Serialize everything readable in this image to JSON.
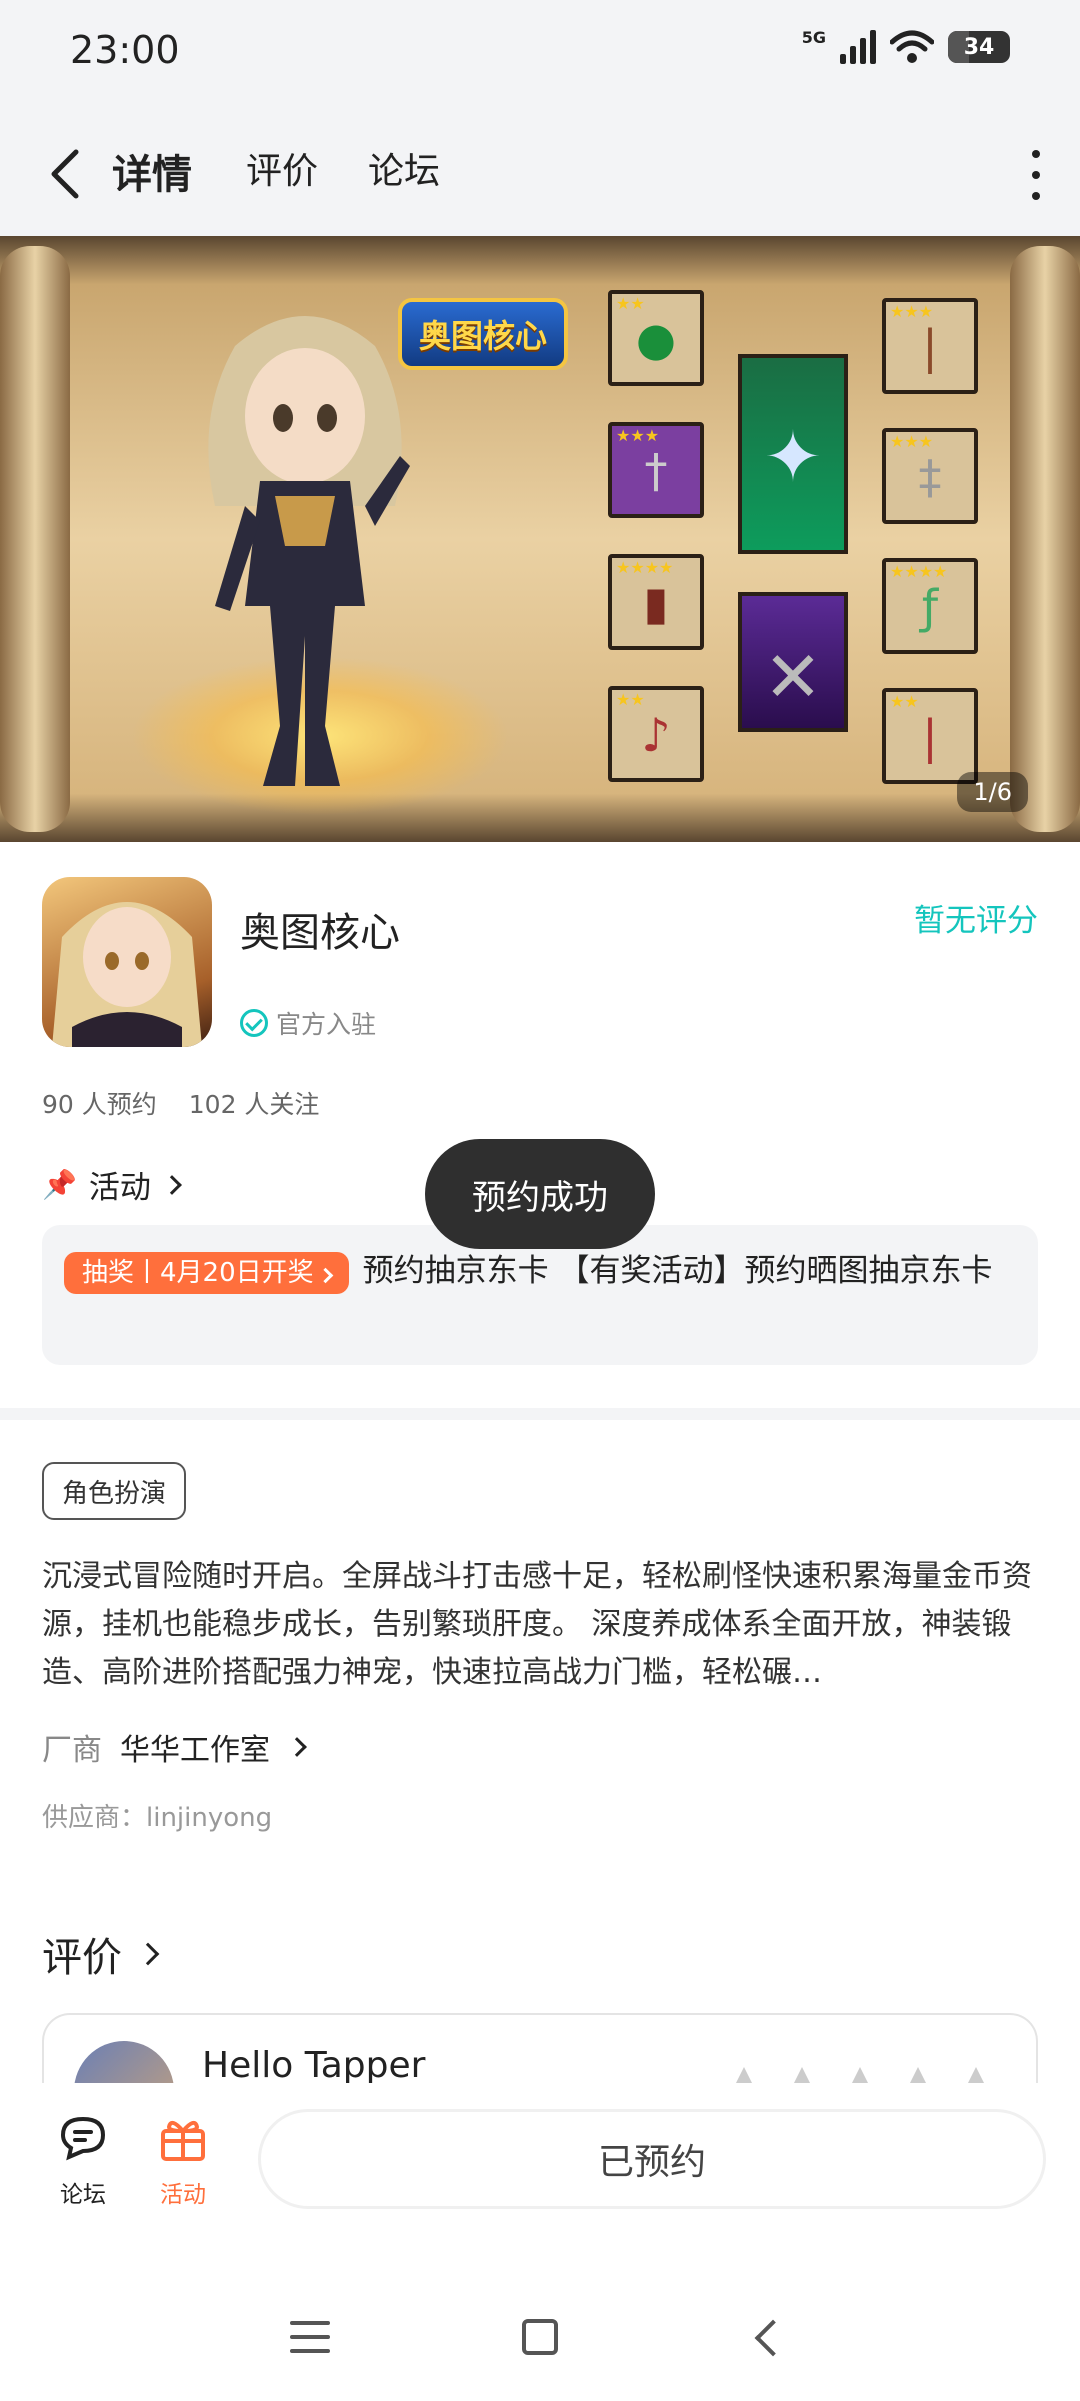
{
  "status_bar": {
    "time": "23:00",
    "network": "5G",
    "battery": "34"
  },
  "nav": {
    "tabs": [
      {
        "label": "详情",
        "active": true
      },
      {
        "label": "评价"
      },
      {
        "label": "论坛"
      }
    ]
  },
  "banner": {
    "logo_text": "奥图核心",
    "counter": "1/6"
  },
  "app": {
    "name": "奥图核心",
    "verified_label": "官方入驻",
    "rating_text": "暂无评分",
    "reservations": "90 人预约",
    "followers": "102 人关注"
  },
  "activity": {
    "title": "活动",
    "badge": "抽奖丨4月20日开奖",
    "text": "预约抽京东卡 【有奖活动】预约晒图抽京东卡"
  },
  "toast": "预约成功",
  "details": {
    "genre_tag": "角色扮演",
    "description": "沉浸式冒险随时开启。全屏战斗打击感十足，轻松刷怪快速积累海量金币资源，挂机也能稳步成长，告别繁琐肝度。 深度养成体系全面开放，神装锻造、高阶进阶搭配强力神宠，快速拉高战力门槛，轻松碾…",
    "vendor_label": "厂商",
    "vendor_name": "华华工作室",
    "supplier": "供应商：linjinyong"
  },
  "reviews": {
    "title": "评价",
    "first_user": "Hello Tapper"
  },
  "bottom_bar": {
    "forum_label": "论坛",
    "activity_label": "活动",
    "reserved_button": "已预约"
  },
  "colors": {
    "accent": "#14c5bd",
    "orange": "#ff6f3c"
  }
}
